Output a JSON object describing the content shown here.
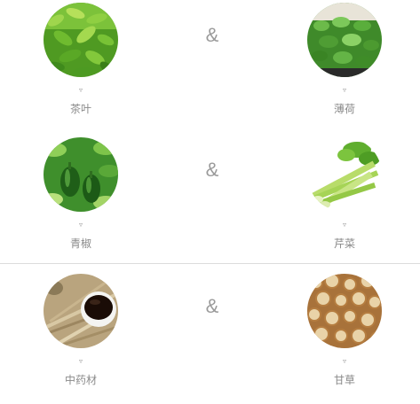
{
  "pairs": [
    {
      "left": {
        "name": "茶叶",
        "icon": "tea-leaves-image",
        "caret": "▿"
      },
      "joiner": "&",
      "right": {
        "name": "薄荷",
        "icon": "mint-image",
        "caret": "▿"
      }
    },
    {
      "left": {
        "name": "青椒",
        "icon": "green-pepper-image",
        "caret": "▿"
      },
      "joiner": "&",
      "right": {
        "name": "芹菜",
        "icon": "celery-image",
        "caret": "▿"
      }
    },
    {
      "left": {
        "name": "中药材",
        "icon": "herbal-medicine-image",
        "caret": "▿"
      },
      "joiner": "&",
      "right": {
        "name": "甘草",
        "icon": "licorice-root-image",
        "caret": "▿"
      }
    }
  ],
  "colors": {
    "label": "#8a8a8a",
    "joiner": "#9a9a9a",
    "divider": "#dcdcdc"
  }
}
